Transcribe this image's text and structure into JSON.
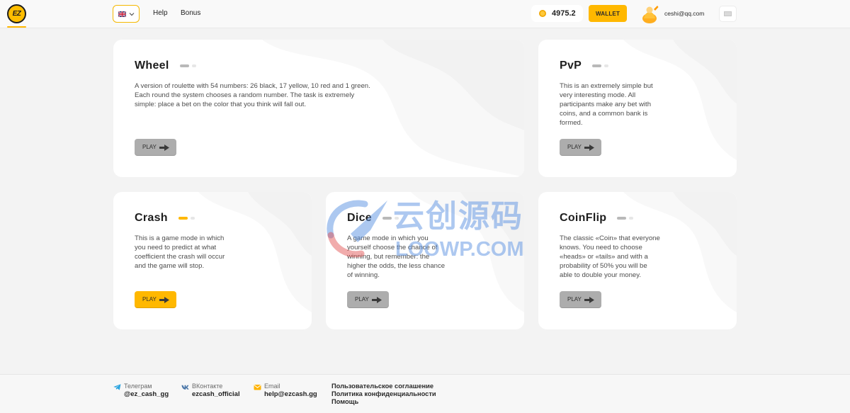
{
  "app": {
    "logo_text": "EZ",
    "colors": {
      "accent": "#ffb800",
      "button_inactive": "#adadad",
      "indicator_inactive": "#b9b9b9",
      "telegram": "#2ca5e0",
      "vk": "#4a76a8"
    }
  },
  "header": {
    "language_flag_icon": "uk-flag-icon",
    "nav": {
      "help": "Help",
      "bonus": "Bonus"
    },
    "coin_icon": "coin-icon",
    "balance": "4975.2",
    "wallet_label": "WALLET",
    "user_email": "ceshi@qq.com"
  },
  "games": [
    {
      "title": "Wheel",
      "description": [
        "A version of roulette with 54 numbers: 26 black, 17 yellow, 10 red and 1 green.",
        "Each round the system chooses a random number. The task is extremely",
        "simple: place a bet on the color that you think will fall out."
      ],
      "play_label": "PLAY",
      "indicator_color": "#b9b9b9",
      "button_color": "#adadad"
    },
    {
      "title": "PvP",
      "description": [
        "This is an extremely simple but",
        "very interesting mode. All",
        "participants make any bet with",
        "coins, and a common bank is",
        "formed."
      ],
      "play_label": "PLAY",
      "indicator_color": "#b9b9b9",
      "button_color": "#adadad"
    },
    {
      "title": "Crash",
      "description": [
        "This is a game mode in which",
        "you need to predict at what",
        "coefficient the crash will occur",
        "and the game will stop."
      ],
      "play_label": "PLAY",
      "indicator_color": "#ffb800",
      "button_color": "#ffb800"
    },
    {
      "title": "Dice",
      "description": [
        "A game mode in which you",
        "yourself choose the chance of",
        "winning, but remember: the",
        "higher the odds, the less chance",
        "of winning."
      ],
      "play_label": "PLAY",
      "indicator_color": "#b9b9b9",
      "button_color": "#adadad"
    },
    {
      "title": "CoinFlip",
      "description": [
        "The classic «Coin» that everyone",
        "knows. You need to choose",
        "«heads» or «tails» and with a",
        "probability of 50% you will be",
        "able to double your money."
      ],
      "play_label": "PLAY",
      "indicator_color": "#b9b9b9",
      "button_color": "#adadad"
    }
  ],
  "footer": {
    "contacts": [
      {
        "icon": "telegram-icon",
        "label": "Телеграм",
        "value": "@ez_cash_gg"
      },
      {
        "icon": "vk-icon",
        "label": "ВКонтакте",
        "value": "ezcash_official"
      },
      {
        "icon": "email-icon",
        "label": "Email",
        "value": "help@ezcash.gg"
      }
    ],
    "links": [
      "Пользовательское соглашение",
      "Политика конфиденциальности",
      "Помощь"
    ]
  },
  "watermark": {
    "title": "云创源码",
    "domain": "LOOWP.COM"
  }
}
